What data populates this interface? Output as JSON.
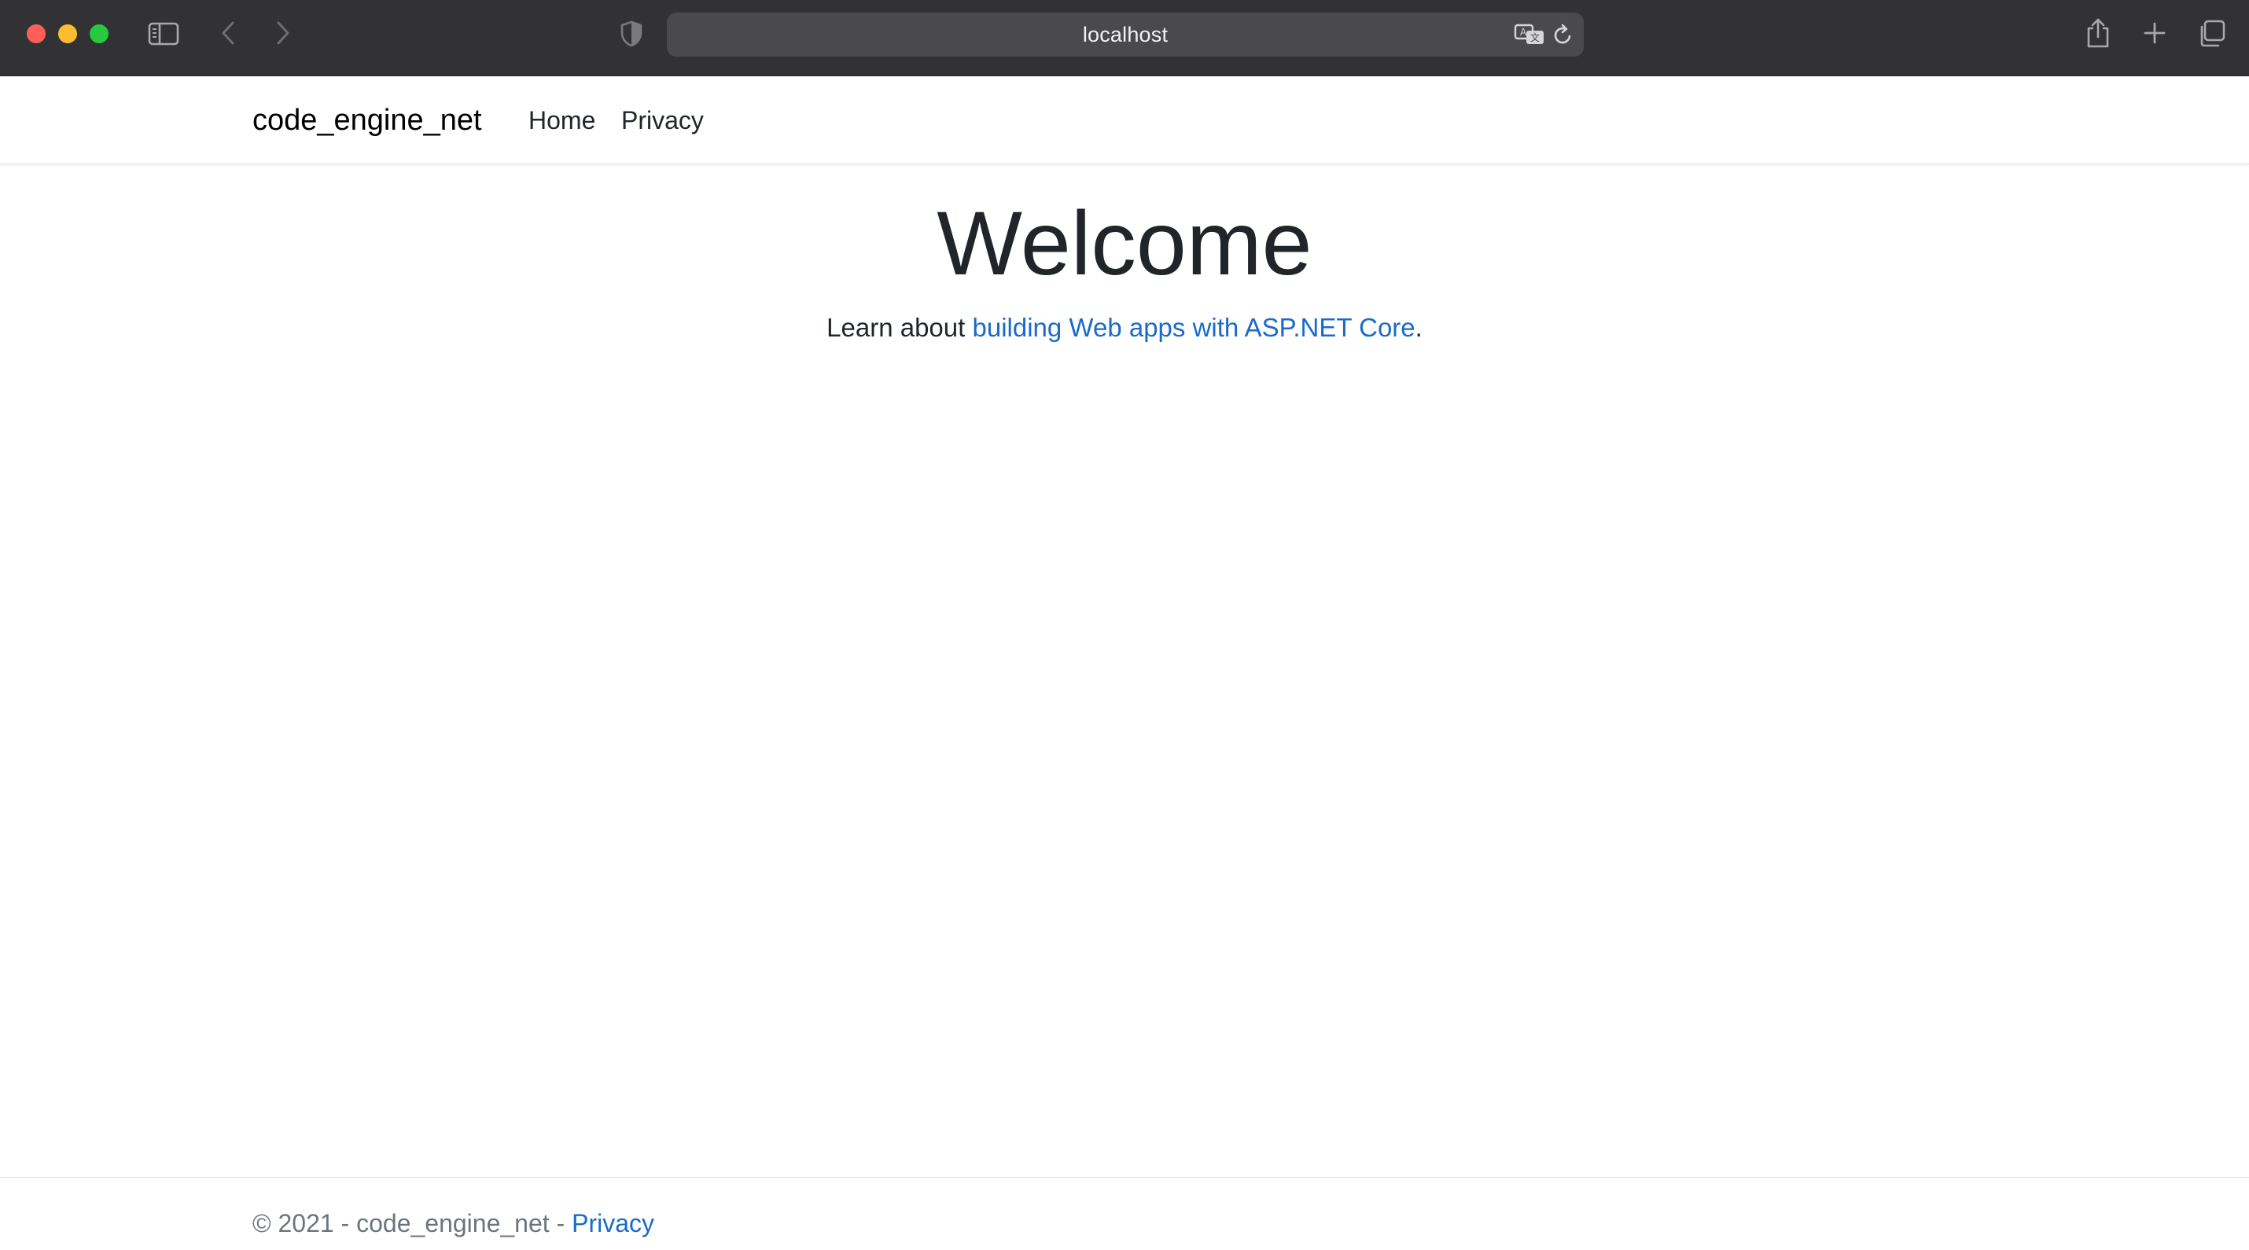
{
  "browser": {
    "url": "localhost",
    "icons": [
      "sidebar-icon",
      "chevron-left-icon",
      "chevron-right-icon",
      "shield-icon",
      "translate-icon",
      "reload-icon",
      "share-icon",
      "plus-icon",
      "tabs-overview-icon"
    ],
    "colors": {
      "close": "#ff5f57",
      "minimize": "#febc2e",
      "zoom": "#28c840",
      "toolbar": "#323234",
      "address_bar": "#4a4a4d"
    }
  },
  "navbar": {
    "brand": "code_engine_net",
    "links": [
      {
        "label": "Home"
      },
      {
        "label": "Privacy"
      }
    ]
  },
  "main": {
    "title": "Welcome",
    "lead_prefix": "Learn about ",
    "lead_link": "building Web apps with ASP.NET Core",
    "lead_suffix": ".",
    "link_color": "#1b6ac9"
  },
  "footer": {
    "text": "© 2021 - code_engine_net - ",
    "link": "Privacy"
  }
}
